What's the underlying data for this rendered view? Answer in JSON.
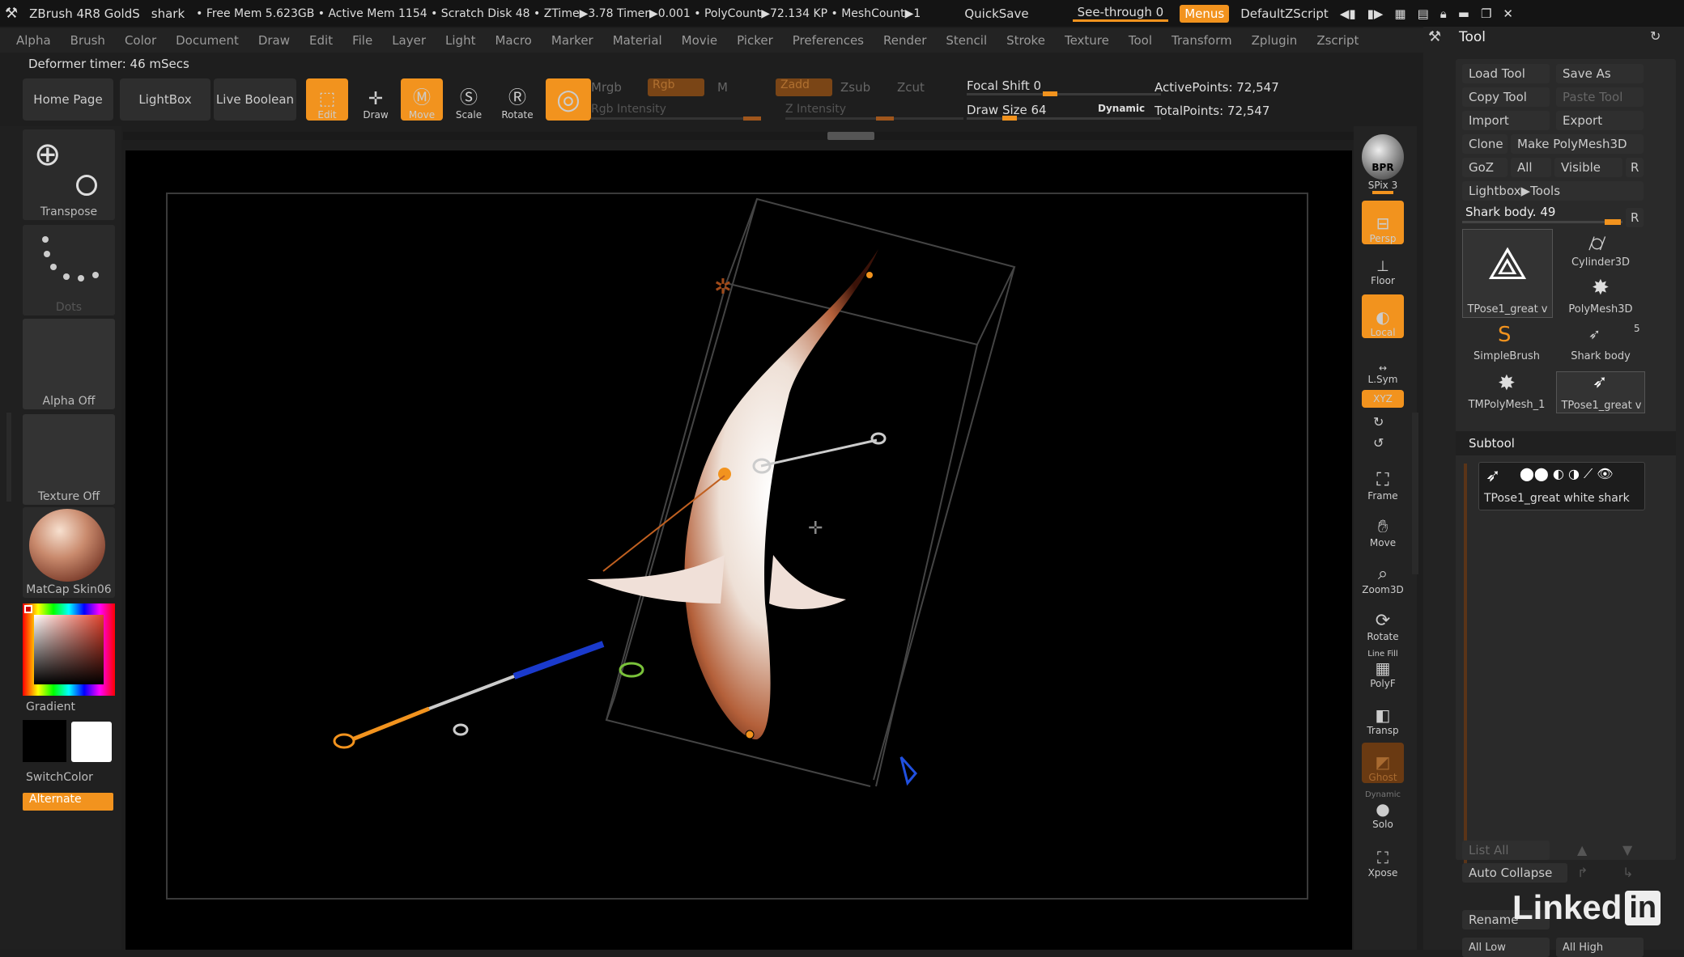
{
  "titlebar": {
    "app": "ZBrush 4R8 GoldS",
    "doc": "shark",
    "stats": "• Free Mem 5.623GB • Active Mem 1154 • Scratch Disk 48 • ZTime▶3.78 Timer▶0.001 • PolyCount▶72.134 KP • MeshCount▶1",
    "quicksave": "QuickSave",
    "see_through": "See-through 0",
    "menus": "Menus",
    "default_script": "DefaultZScript"
  },
  "menu": [
    "Alpha",
    "Brush",
    "Color",
    "Document",
    "Draw",
    "Edit",
    "File",
    "Layer",
    "Light",
    "Macro",
    "Marker",
    "Material",
    "Movie",
    "Picker",
    "Preferences",
    "Render",
    "Stencil",
    "Stroke",
    "Texture",
    "Tool",
    "Transform",
    "Zplugin",
    "Zscript"
  ],
  "status": {
    "deformer_timer": "Deformer timer: 46 mSecs"
  },
  "shelf": {
    "home": "Home Page",
    "lightbox": "LightBox",
    "live_boolean": "Live Boolean",
    "edit": "Edit",
    "draw": "Draw",
    "move": "Move",
    "scale": "Scale",
    "rotate": "Rotate",
    "mrgb": "Mrgb",
    "rgb": "Rgb",
    "m": "M",
    "zadd": "Zadd",
    "zsub": "Zsub",
    "zcut": "Zcut",
    "rgb_intensity": "Rgb Intensity",
    "z_intensity": "Z Intensity",
    "focal_shift": "Focal Shift 0",
    "draw_size": "Draw Size 64",
    "dynamic": "Dynamic",
    "active_points": "ActivePoints: 72,547",
    "total_points": "TotalPoints: 72,547"
  },
  "left": {
    "transpose": "Transpose",
    "dots": "Dots",
    "alpha": "Alpha Off",
    "texture": "Texture Off",
    "matcap": "MatCap Skin06",
    "gradient": "Gradient",
    "switchcolor": "SwitchColor",
    "alternate": "Alternate"
  },
  "righttools": {
    "bpr": "BPR",
    "spix": "SPix 3",
    "persp": "Persp",
    "floor": "Floor",
    "local": "Local",
    "lsym": "L.Sym",
    "xyz": "XYZ",
    "frame": "Frame",
    "move": "Move",
    "zoom3d": "Zoom3D",
    "rotate": "Rotate",
    "polyf": "PolyF",
    "linefill": "Line Fill",
    "transp": "Transp",
    "ghost": "Ghost",
    "dynamic": "Dynamic",
    "solo": "Solo",
    "xpose": "Xpose"
  },
  "toolpanel": {
    "title": "Tool",
    "load_tool": "Load Tool",
    "save_as": "Save As",
    "copy_tool": "Copy Tool",
    "paste_tool": "Paste Tool",
    "import": "Import",
    "export": "Export",
    "clone": "Clone",
    "make_polymesh": "Make PolyMesh3D",
    "goz": "GoZ",
    "all": "All",
    "visible": "Visible",
    "r": "R",
    "lightbox_tools": "Lightbox▶Tools",
    "shark_body_slider": "Shark body. 49",
    "thumbs": [
      {
        "label": "TPose1_great v"
      },
      {
        "label": "Cylinder3D"
      },
      {
        "label": "PolyMesh3D"
      },
      {
        "label": "SimpleBrush"
      },
      {
        "label": "Shark body"
      },
      {
        "label": "TMPolyMesh_1"
      },
      {
        "label": "TPose1_great v"
      }
    ],
    "shark_count": "5",
    "subtool": "Subtool",
    "subtool_item": "TPose1_great white shark",
    "list_all": "List All",
    "auto_collapse": "Auto Collapse",
    "rename": "Rename",
    "all_low": "All Low",
    "all_high": "All High"
  },
  "watermark": "Linked",
  "watermark_in": "in"
}
